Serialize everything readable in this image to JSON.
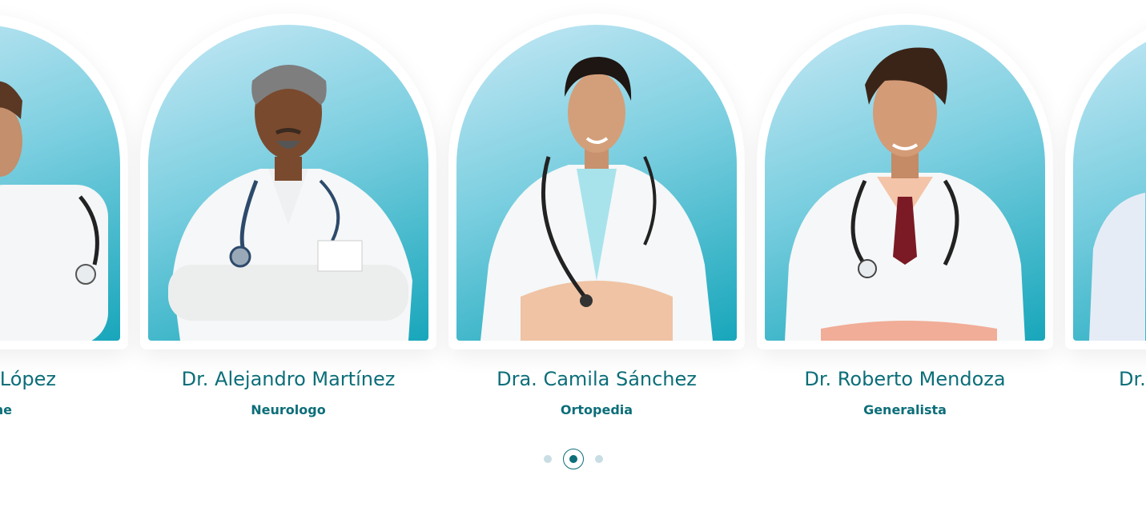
{
  "colors": {
    "accent": "#0c6e79",
    "arch_gradient_top": "#c6e8f5",
    "arch_gradient_bottom": "#18a6bb",
    "dot_inactive": "#c8dde4"
  },
  "doctors": [
    {
      "name": "López",
      "specialty": "ne"
    },
    {
      "name": "Dr. Alejandro Martínez",
      "specialty": "Neurologo"
    },
    {
      "name": "Dra. Camila Sánchez",
      "specialty": "Ortopedia"
    },
    {
      "name": "Dr. Roberto Mendoza",
      "specialty": "Generalista"
    },
    {
      "name": "Dr.",
      "specialty": ""
    }
  ],
  "pagination": {
    "count": 3,
    "active": 2
  }
}
